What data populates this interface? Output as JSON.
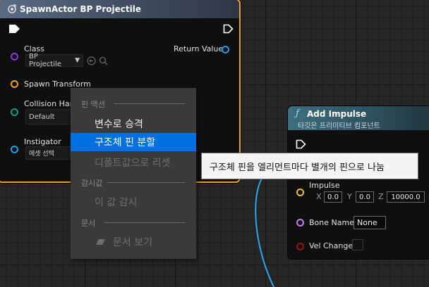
{
  "spawn_node": {
    "title": "SpawnActor BP Projectile",
    "class_label": "Class",
    "class_value": "BP Projectile",
    "return_label": "Return Value",
    "spawn_transform_label": "Spawn Transform",
    "collision_label": "Collision Hand",
    "collision_value": "Default",
    "instigator_label": "Instigator",
    "instigator_value": "에셋 선택"
  },
  "impulse_node": {
    "title": "Add Impulse",
    "subtitle": "타깃은 프리미티브 컴포넌트",
    "impulse_label": "Impulse",
    "x_label": "X",
    "x_value": "0.0",
    "y_label": "Y",
    "y_value": "0.0",
    "z_label": "Z",
    "z_value": "10000.0",
    "bone_label": "Bone Name",
    "bone_value": "None",
    "vel_label": "Vel Change"
  },
  "context_menu": {
    "section_pin_actions": "핀 액션",
    "item_promote": "변수로 승격",
    "item_split": "구조체 핀 분할",
    "item_reset": "디폴트값으로 리셋",
    "section_watch": "감시값",
    "item_watch": "이 값 감시",
    "section_docs": "문서",
    "item_docs": "문서 보기"
  },
  "tooltip": {
    "text": "구조체 핀을 엘리먼트마다 별개의 핀으로 나눔"
  },
  "colors": {
    "selected_border": "#f0a020",
    "menu_highlight": "#0070e0",
    "class_pin": "#8a3ae0",
    "object_pin": "#1aa0e8",
    "struct_pin": "#f0a030",
    "enum_pin": "#10a090",
    "name_pin": "#c080f0",
    "bool_pin": "#a01010",
    "wire": "#2aa8f0"
  },
  "icons": [
    "spawn-node-icon",
    "exec-pin-icon",
    "function-icon",
    "arrow-icon",
    "magnifier-icon",
    "dropdown-chevron-icon",
    "document-icon"
  ]
}
